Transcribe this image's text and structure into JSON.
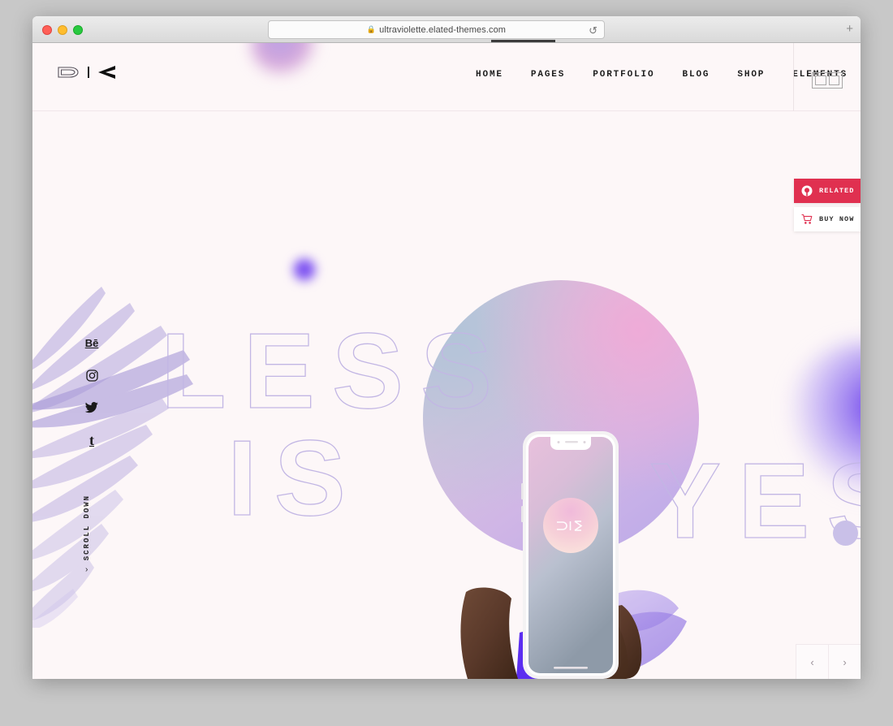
{
  "browser": {
    "url": "ultraviolette.elated-themes.com",
    "lock_icon": "lock-icon",
    "reload_icon": "reload-icon",
    "new_tab_label": "+",
    "traffic_lights": [
      "close",
      "minimize",
      "maximize"
    ]
  },
  "header": {
    "logo_alt": "Ultraviolette logo",
    "nav": [
      {
        "label": "HOME"
      },
      {
        "label": "PAGES"
      },
      {
        "label": "PORTFOLIO"
      },
      {
        "label": "BLOG"
      },
      {
        "label": "SHOP"
      },
      {
        "label": "ELEMENTS"
      }
    ],
    "grid_toggle_icon": "grid-icon"
  },
  "side_actions": [
    {
      "label": "RELATED",
      "icon": "record-circle-icon",
      "color": "#e03050"
    },
    {
      "label": "BUY NOW",
      "icon": "shopping-cart-icon",
      "color": "#ffffff"
    }
  ],
  "social": [
    {
      "name": "behance",
      "glyph": "Bē"
    },
    {
      "name": "instagram",
      "glyph": ""
    },
    {
      "name": "twitter",
      "glyph": ""
    },
    {
      "name": "tumblr",
      "glyph": "t"
    }
  ],
  "scroll": {
    "label": "SCROLL DOWN",
    "chevron": "‹"
  },
  "hero": {
    "line1": "LESS",
    "line2": "IS",
    "line3": "YES",
    "period": "."
  },
  "slider": {
    "prev": "‹",
    "next": "›"
  },
  "colors": {
    "page_background": "#fdf7f8",
    "accent_red": "#e03050",
    "outline_stroke": "#c2b6e4",
    "violet": "#6b3ff0",
    "lavender": "#c9c0e8"
  }
}
